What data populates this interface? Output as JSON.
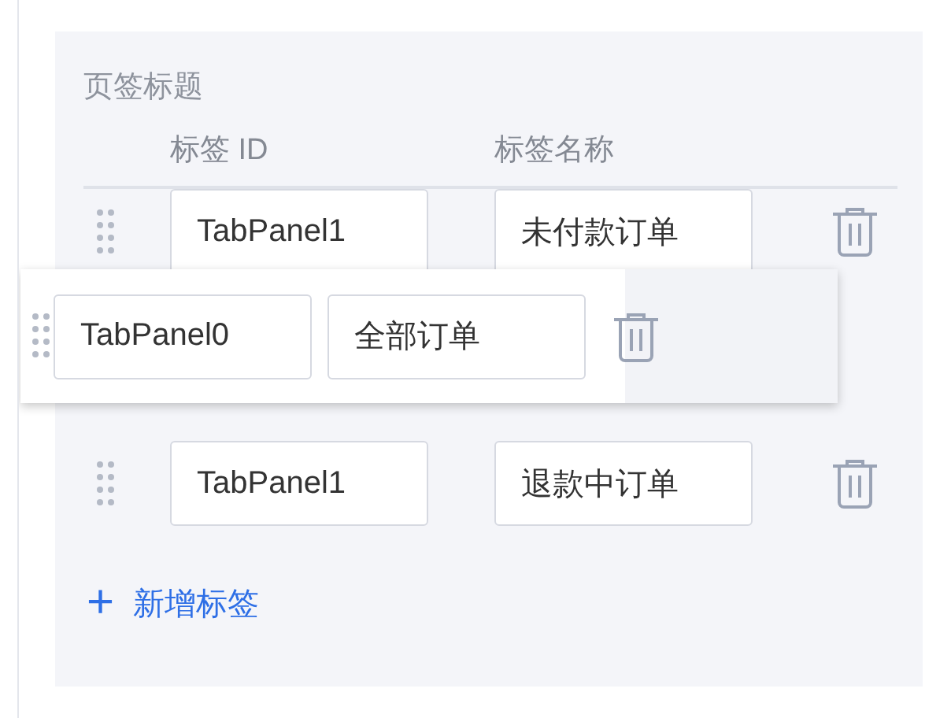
{
  "section_title": "页签标题",
  "columns": [
    "标签 ID",
    "标签名称"
  ],
  "rows": [
    {
      "id": "TabPanel1",
      "name": "未付款订单",
      "dragging": false
    },
    {
      "id": "TabPanel0",
      "name": "全部订单",
      "dragging": true
    },
    {
      "id": "TabPanel1",
      "name": "退款中订单",
      "dragging": false
    }
  ],
  "add_button": {
    "icon": "+",
    "label": "新增标签"
  }
}
